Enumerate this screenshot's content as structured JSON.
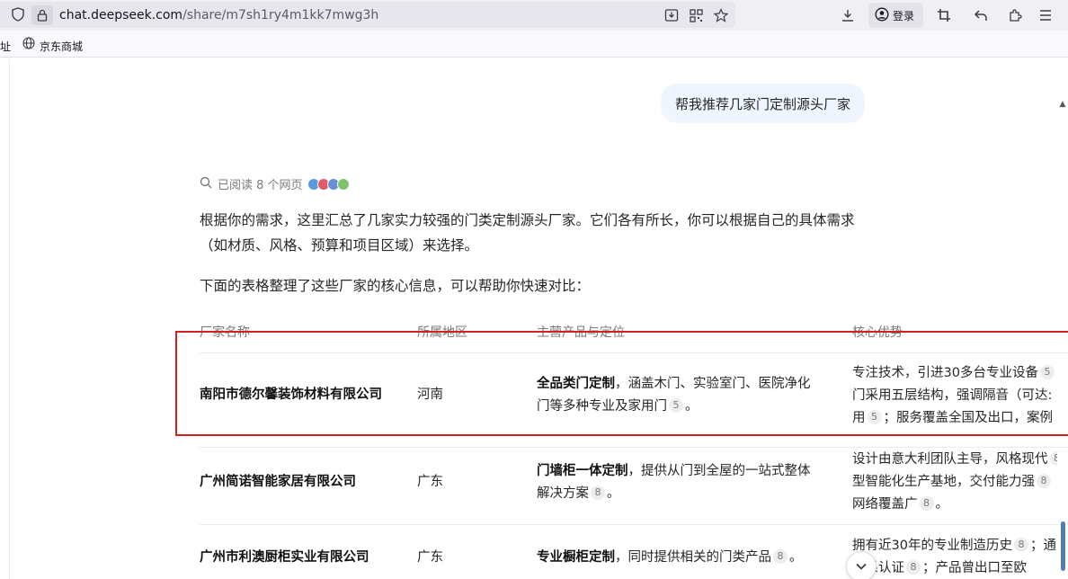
{
  "browser": {
    "url_host": "chat.deepseek.com",
    "url_path": "/share/m7sh1ry4m1kk7mwg3h",
    "login_label": "登录",
    "bookmarks": [
      {
        "label": "址"
      },
      {
        "label": "京东商城"
      }
    ]
  },
  "chat": {
    "user_message": "帮我推荐几家门定制源头厂家",
    "read_status": "已阅读 8 个网页",
    "paragraph1_line1": "根据你的需求，这里汇总了几家实力较强的门类定制源头厂家。它们各有所长，你可以根据自己的具体需求",
    "paragraph1_line2": "（如材质、风格、预算和项目区域）来选择。",
    "paragraph2": "下面的表格整理了这些厂家的核心信息，可以帮助你快速对比：",
    "table": {
      "headers": [
        "厂家名称",
        "所属地区",
        "主营产品与定位",
        "核心优势"
      ],
      "rows": [
        {
          "name": "南阳市德尔馨装饰材料有限公司",
          "region": "河南",
          "product_bold": "全品类门定制",
          "product_rest1": "，涵盖木门、实验室门、医院净化",
          "product_line2": "门等多种专业及家用门",
          "product_cite": "5",
          "adv_line1": "专注技术，引进30多台专业设备",
          "adv_cite1": "5",
          "adv_line2": "门采用五层结构，强调隔音（可达:",
          "adv_line3a": "用",
          "adv_cite3": "5",
          "adv_line3b": "；服务覆盖全国及出口，案例",
          "end_mark": "。"
        },
        {
          "name": "广州简诺智能家居有限公司",
          "region": "广东",
          "product_bold": "门墙柜一体定制",
          "product_rest1": "，提供从门到全屋的一站式整体",
          "product_line2": "解决方案",
          "product_cite": "8",
          "adv_line1": "设计由意大利团队主导，风格现代",
          "adv_cite1": "8",
          "adv_line2a": "型智能化生产基地，交付能力强",
          "adv_cite2": "8",
          "adv_line3a": "网络覆盖广",
          "adv_cite3": "8",
          "end_mark": "。"
        },
        {
          "name": "广州市利澳厨柜实业有限公司",
          "region": "广东",
          "product_bold": "专业橱柜定制",
          "product_rest1": "，同时提供相关的门类产品",
          "product_cite": "8",
          "adv_line1": "拥有近30年的专业制造历史",
          "adv_cite1": "8",
          "adv_line1b": "；通",
          "adv_line2a": "体系认证",
          "adv_cite2": "8",
          "adv_line2b": "；产品曾出口至欧",
          "end_mark": "。"
        }
      ]
    }
  },
  "colors": {
    "highlight": "#d21f1f",
    "bubble": "#eff6ff"
  }
}
